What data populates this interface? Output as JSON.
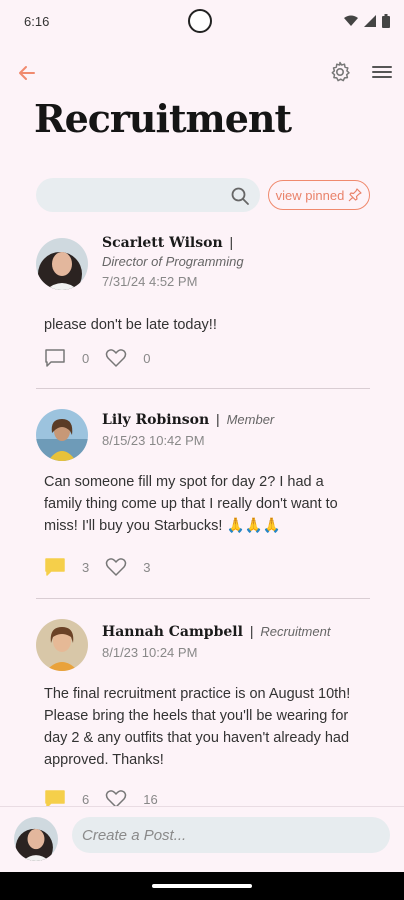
{
  "status": {
    "time": "6:16"
  },
  "header": {
    "title": "Recruitment"
  },
  "search": {
    "placeholder": ""
  },
  "view_pinned": {
    "label": "view pinned"
  },
  "posts": [
    {
      "author": "Scarlett Wilson",
      "separator": "|",
      "role": "Director of Programming",
      "timestamp": "7/31/24 4:52 PM",
      "body": "please don't be late today!!",
      "comments": "0",
      "likes": "0"
    },
    {
      "author": "Lily Robinson",
      "separator": "|",
      "role": "Member",
      "timestamp": "8/15/23 10:42 PM",
      "body": "Can someone fill my spot for day 2? I had a family thing come up that I really don't want to miss! I'll buy you Starbucks! 🙏🙏🙏",
      "comments": "3",
      "likes": "3"
    },
    {
      "author": "Hannah Campbell",
      "separator": "|",
      "role": "Recruitment",
      "timestamp": "8/1/23 10:24 PM",
      "body": "The final recruitment practice is on August 10th! Please bring the heels that you'll be wearing for day 2 & any outfits that you haven't already had approved. Thanks!",
      "comments": "6",
      "likes": "16"
    }
  ],
  "composer": {
    "placeholder": "Create a Post..."
  },
  "colors": {
    "accent": "#f08a6e",
    "comment_active": "#f5cf4a",
    "background": "#fdf3f8"
  },
  "icons": [
    "back-arrow-icon",
    "gear-icon",
    "hamburger-menu-icon",
    "search-icon",
    "pin-icon",
    "comment-icon",
    "heart-icon"
  ]
}
